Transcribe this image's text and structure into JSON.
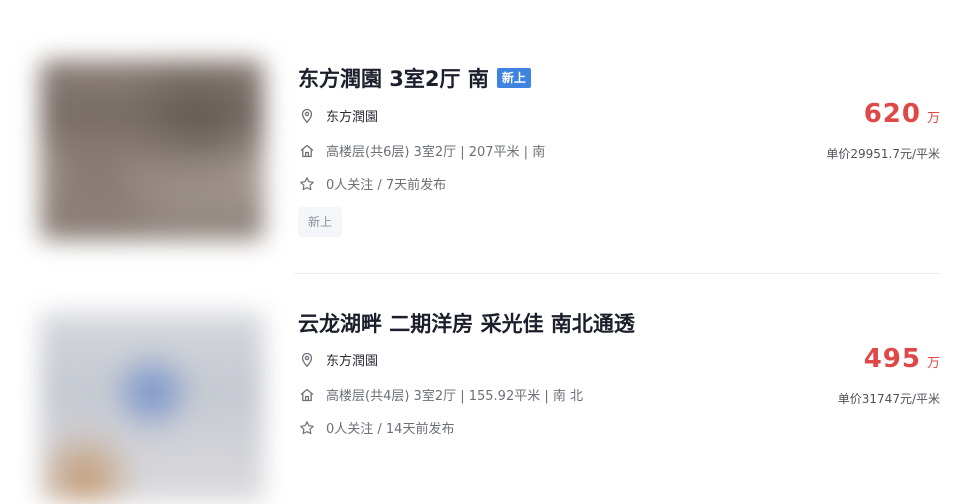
{
  "listings": [
    {
      "title": "东方潤園 3室2厅 南",
      "badge": "新上",
      "location_icon": "location-pin-icon",
      "location": "东方潤園",
      "house_icon": "house-icon",
      "house_info": "高楼层(共6层) 3室2厅 | 207平米 | 南",
      "follow_icon": "star-icon",
      "follow_info": "0人关注 / 7天前发布",
      "tag": "新上",
      "price": "620",
      "price_unit": "万",
      "unit_price": "单价29951.7元/平米"
    },
    {
      "title": "云龙湖畔 二期洋房 采光佳 南北通透",
      "location_icon": "location-pin-icon",
      "location": "东方潤園",
      "house_icon": "house-icon",
      "house_info": "高楼层(共4层) 3室2厅 | 155.92平米 | 南 北",
      "follow_icon": "star-icon",
      "follow_info": "0人关注 / 14天前发布",
      "price": "495",
      "price_unit": "万",
      "unit_price": "单价31747元/平米"
    }
  ],
  "colors": {
    "price": "#e04747",
    "badge": "#3d83e0",
    "title": "#1b1e2b",
    "tag_bg": "#f4f6f9"
  }
}
